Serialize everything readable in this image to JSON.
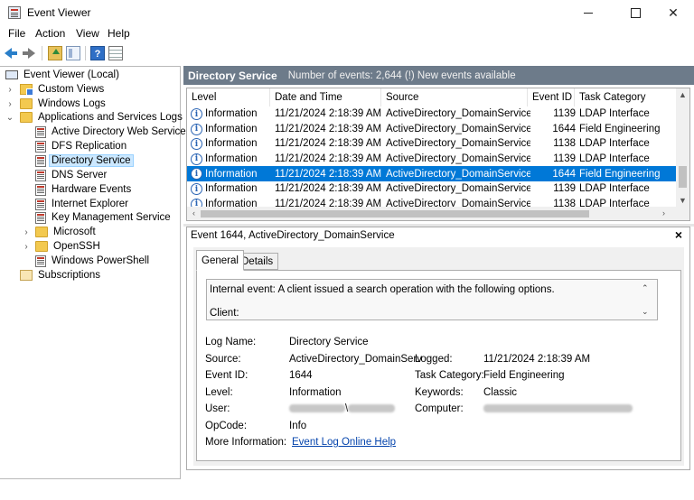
{
  "window": {
    "title": "Event Viewer"
  },
  "menu": [
    "File",
    "Action",
    "View",
    "Help"
  ],
  "toolbar": {
    "icons": [
      "back-arrow-icon",
      "forward-arrow-icon",
      "folder-up-icon",
      "show-hide-pane-icon",
      "help-icon",
      "properties-icon"
    ]
  },
  "tree": {
    "root": "Event Viewer (Local)",
    "custom_views": "Custom Views",
    "windows_logs": "Windows Logs",
    "apps_services": "Applications and Services Logs",
    "children": [
      "Active Directory Web Services",
      "DFS Replication",
      "Directory Service",
      "DNS Server",
      "Hardware Events",
      "Internet Explorer",
      "Key Management Service",
      "Microsoft",
      "OpenSSH",
      "Windows PowerShell"
    ],
    "subscriptions": "Subscriptions"
  },
  "header": {
    "title": "Directory Service",
    "count": "Number of events: 2,644 (!) New events available"
  },
  "columns": [
    "Level",
    "Date and Time",
    "Source",
    "Event ID",
    "Task Category"
  ],
  "events": [
    [
      "Information",
      "11/21/2024 2:18:39 AM",
      "ActiveDirectory_DomainService",
      "1139",
      "LDAP Interface"
    ],
    [
      "Information",
      "11/21/2024 2:18:39 AM",
      "ActiveDirectory_DomainService",
      "1644",
      "Field Engineering"
    ],
    [
      "Information",
      "11/21/2024 2:18:39 AM",
      "ActiveDirectory_DomainService",
      "1138",
      "LDAP Interface"
    ],
    [
      "Information",
      "11/21/2024 2:18:39 AM",
      "ActiveDirectory_DomainService",
      "1139",
      "LDAP Interface"
    ],
    [
      "Information",
      "11/21/2024 2:18:39 AM",
      "ActiveDirectory_DomainService",
      "1644",
      "Field Engineering"
    ],
    [
      "Information",
      "11/21/2024 2:18:39 AM",
      "ActiveDirectory_DomainService",
      "1139",
      "LDAP Interface"
    ],
    [
      "Information",
      "11/21/2024 2:18:39 AM",
      "ActiveDirectory_DomainService",
      "1138",
      "LDAP Interface"
    ]
  ],
  "selected_event_index": 4,
  "detail": {
    "title": "Event 1644, ActiveDirectory_DomainService",
    "tabs": [
      "General",
      "Details"
    ],
    "description_line1": "Internal event: A client issued a search operation with the following options.",
    "description_line2": "Client:",
    "labels": {
      "log_name": "Log Name:",
      "source": "Source:",
      "event_id": "Event ID:",
      "level": "Level:",
      "user": "User:",
      "opcode": "OpCode:",
      "more_info": "More Information:",
      "logged": "Logged:",
      "task_category": "Task Category:",
      "keywords": "Keywords:",
      "computer": "Computer:"
    },
    "values": {
      "log_name": "Directory Service",
      "source": "ActiveDirectory_DomainServ",
      "event_id": "1644",
      "level": "Information",
      "user_sep": "\\",
      "opcode": "Info",
      "more_info_link": "Event Log Online Help",
      "logged": "11/21/2024 2:18:39 AM",
      "task_category": "Field Engineering",
      "keywords": "Classic"
    }
  }
}
